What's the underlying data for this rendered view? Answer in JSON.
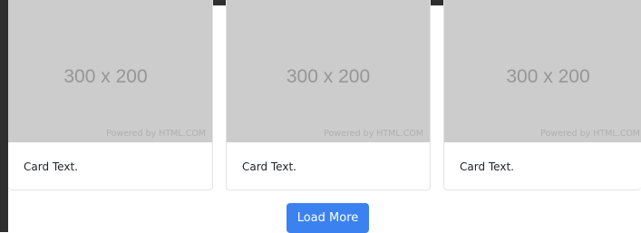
{
  "cards": [
    {
      "image_label": "300 x 200",
      "image_credit": "Powered by HTML.COM",
      "text": "Card Text."
    },
    {
      "image_label": "300 x 200",
      "image_credit": "Powered by HTML.COM",
      "text": "Card Text."
    },
    {
      "image_label": "300 x 200",
      "image_credit": "Powered by HTML.COM",
      "text": "Card Text."
    }
  ],
  "load_more_label": "Load More",
  "colors": {
    "placeholder_bg": "#cccccc",
    "button_bg": "#3b82f0",
    "frame": "#2f2f2f"
  }
}
